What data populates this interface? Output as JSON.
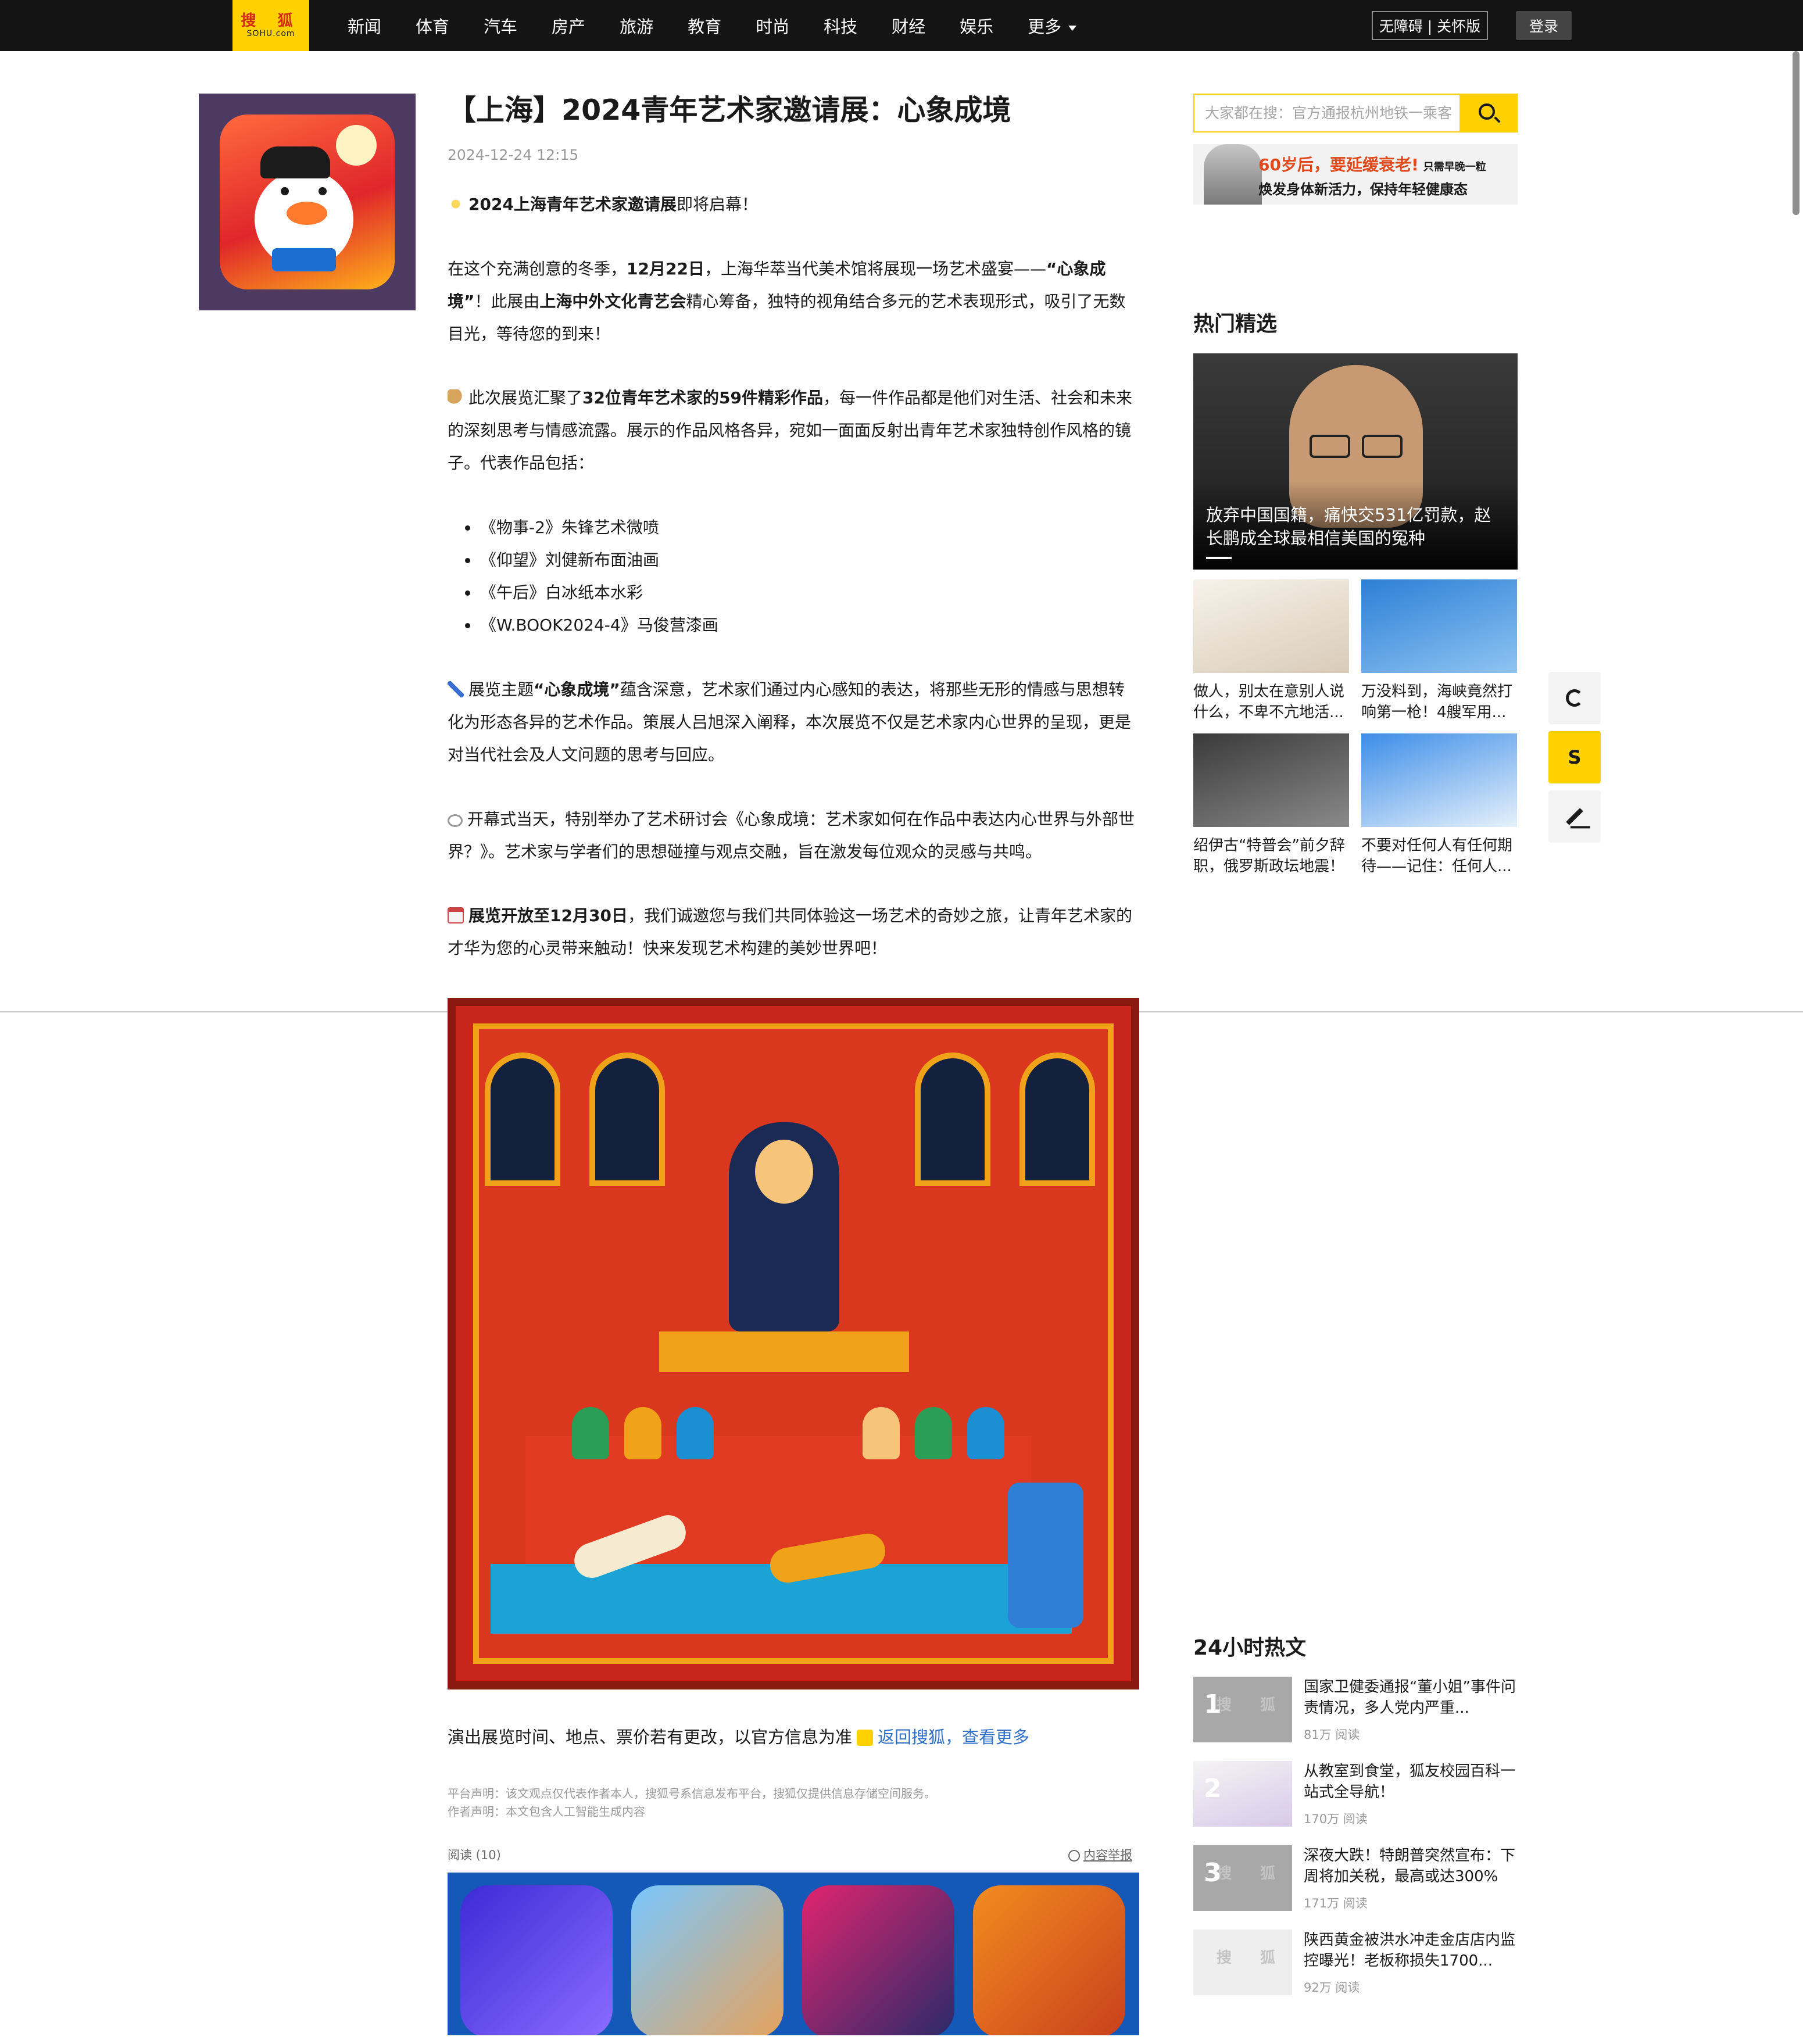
{
  "header": {
    "logo_line1": "搜 狐",
    "logo_line2": "SOHU.com",
    "nav": [
      "新闻",
      "体育",
      "汽车",
      "房产",
      "旅游",
      "教育",
      "时尚",
      "科技",
      "财经",
      "娱乐"
    ],
    "more": "更多",
    "accessibility": "无障碍 | 关怀版",
    "login": "登录"
  },
  "article": {
    "title": "【上海】2024青年艺术家邀请展：心象成境",
    "date": "2024-12-24 12:15",
    "p1_bold": "2024上海青年艺术家邀请展",
    "p1_rest": "即将启幕！",
    "p2_a": "在这个充满创意的冬季，",
    "p2_b": "12月22日",
    "p2_c": "，上海华萃当代美术馆将展现一场艺术盛宴——",
    "p2_d": "“心象成境”",
    "p2_e": "！此展由",
    "p2_f": "上海中外文化青艺会",
    "p2_g": "精心筹备，独特的视角结合多元的艺术表现形式，吸引了无数目光，等待您的到来！",
    "p3_a": "此次展览汇聚了",
    "p3_b": "32位青年艺术家的59件精彩作品",
    "p3_c": "，每一件作品都是他们对生活、社会和未来的深刻思考与情感流露。展示的作品风格各异，宛如一面面反射出青年艺术家独特创作风格的镜子。代表作品包括：",
    "works": [
      "《物事-2》朱锋艺术微喷",
      "《仰望》刘健新布面油画",
      "《午后》白冰纸本水彩",
      "《W.BOOK2024-4》马俊营漆画"
    ],
    "p4_a": "展览主题",
    "p4_b": "“心象成境”",
    "p4_c": "蕴含深意，艺术家们通过内心感知的表达，将那些无形的情感与思想转化为形态各异的艺术作品。策展人吕旭深入阐释，本次展览不仅是艺术家内心世界的呈现，更是对当代社会及人文问题的思考与回应。",
    "p5": "开幕式当天，特别举办了艺术研讨会《心象成境：艺术家如何在作品中表达内心世界与外部世界？》。艺术家与学者们的思想碰撞与观点交融，旨在激发每位观众的灵感与共鸣。",
    "p6_a": "展览开放至12月30日",
    "p6_b": "，我们诚邀您与我们共同体验这一场艺术的奇妙之旅，让青年艺术家的才华为您的心灵带来触动！快来发现艺术构建的美妙世界吧！",
    "notice_text": "演出展览时间、地点、票价若有更改，以官方信息为准",
    "back_link": "返回搜狐，",
    "more_link": "查看更多",
    "platform_decl": "平台声明：该文观点仅代表作者本人，搜狐号系信息发布平台，搜狐仅提供信息存储空间服务。",
    "author_decl": "作者声明：本文包含人工智能生成内容",
    "reads": "阅读 (10)",
    "report": "内容举报"
  },
  "sidebar": {
    "search_placeholder": "大家都在搜：官方通报杭州地铁一乘客",
    "banner_line1": "60岁后，要延缓衰老!",
    "banner_line1_small": "只需早晚一粒",
    "banner_line2": "焕发身体新活力，保持年轻健康态",
    "hot_title": "热门精选",
    "hot_main_caption": "放弃中国国籍，痛快交531亿罚款，赵长鹏成全球最相信美国的冤种",
    "hot_cards": [
      "做人，别太在意别人说什么，不卑不亢地活...",
      "万没料到，海峡竟然打响第一枪！4艘军用...",
      "绍伊古“特普会”前夕辞职，俄罗斯政坛地震！",
      "不要对任何人有任何期待——记住：任何人..."
    ],
    "h24_title": "24小时热文",
    "h24": [
      {
        "num": "1",
        "title": "国家卫健委通报“董小姐”事件问责情况，多人党内严重...",
        "reads": "81万 阅读"
      },
      {
        "num": "2",
        "title": "从教室到食堂，狐友校园百科一站式全导航！",
        "reads": "170万 阅读"
      },
      {
        "num": "3",
        "title": "深夜大跌！特朗普突然宣布：下周将加关税，最高或达300%",
        "reads": "171万 阅读"
      },
      {
        "num": "",
        "title": "陕西黄金被洪水冲走金店店内监控曝光！老板称损失1700...",
        "reads": "92万 阅读"
      }
    ],
    "thumb_placeholder": "搜 狐"
  },
  "side_tools": {
    "sohu_glyph": "S"
  },
  "colors": {
    "brand_yellow": "#ffd100",
    "topbar": "#141414",
    "link_blue": "#2f6fc8"
  }
}
